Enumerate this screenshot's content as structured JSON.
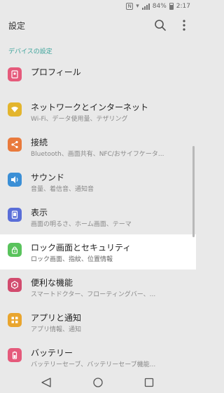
{
  "status_bar": {
    "nfc": "N",
    "battery": "84%",
    "time": "2:17"
  },
  "app_bar": {
    "title": "設定",
    "icons": [
      "search-icon",
      "more-vert-icon"
    ]
  },
  "section_header": "デバイスの設定",
  "items": [
    {
      "title": "プロフィール",
      "subtitle": "",
      "icon": "profile-icon",
      "color": "#e55a7b"
    },
    {
      "title": "ネットワークとインターネット",
      "subtitle": "Wi-Fi、データ使用量、テザリング",
      "icon": "wifi-icon",
      "color": "#e3b52d"
    },
    {
      "title": "接続",
      "subtitle": "Bluetooth、画面共有、NFC/おサイフケータ...",
      "icon": "share-icon",
      "color": "#e97a3c"
    },
    {
      "title": "サウンド",
      "subtitle": "音量、着信音、通知音",
      "icon": "speaker-icon",
      "color": "#3b8fd6"
    },
    {
      "title": "表示",
      "subtitle": "画面の明るさ、ホーム画面、テーマ",
      "icon": "display-icon",
      "color": "#5a6ed8"
    },
    {
      "title": "ロック画面とセキュリティ",
      "subtitle": "ロック画面、指紋、位置情報",
      "icon": "lock-icon",
      "color": "#59c35c"
    },
    {
      "title": "便利な機能",
      "subtitle": "スマートドクター、フローティングバー、...",
      "icon": "gear-icon",
      "color": "#d24b6e"
    },
    {
      "title": "アプリと通知",
      "subtitle": "アプリ情報、通知",
      "icon": "apps-icon",
      "color": "#e9a52e"
    },
    {
      "title": "バッテリー",
      "subtitle": "バッテリーセーブ、バッテリーセーブ機能...",
      "icon": "battery-icon",
      "color": "#e55a7b"
    }
  ],
  "selected_index": 5,
  "nav": [
    "back-icon",
    "home-icon",
    "recent-apps-icon"
  ]
}
